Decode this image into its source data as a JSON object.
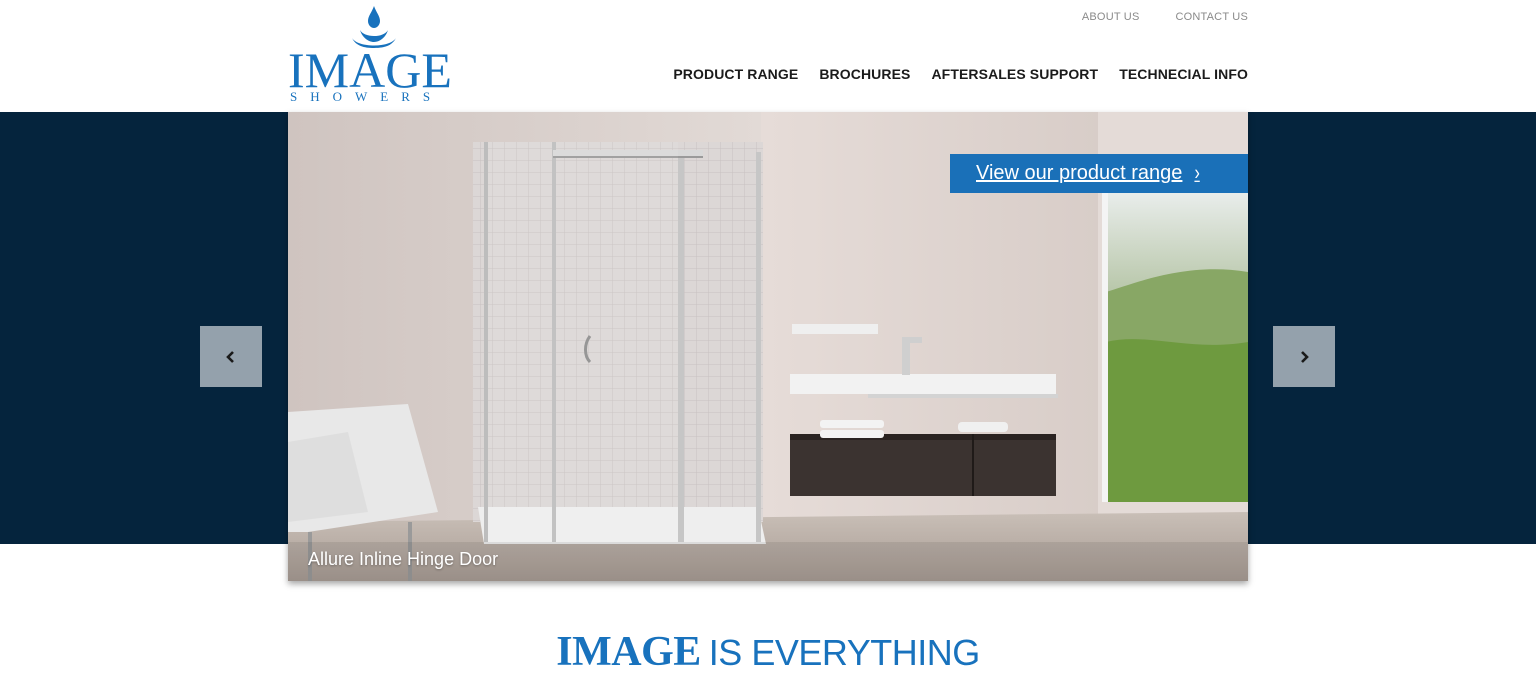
{
  "brand": {
    "name": "IMAGE",
    "subtitle": "SHOWERS",
    "color": "#1872bd"
  },
  "top_links": [
    "ABOUT US",
    "CONTACT US"
  ],
  "main_nav": [
    "PRODUCT RANGE",
    "BROCHURES",
    "AFTERSALES SUPPORT",
    "TECHNECIAL INFO"
  ],
  "slider": {
    "cta_label": "View our product range",
    "caption": "Allure Inline Hinge Door",
    "prev_icon": "chevron-left-icon",
    "next_icon": "chevron-right-icon"
  },
  "tagline": {
    "brand": "IMAGE",
    "rest": "IS EVERYTHING"
  },
  "colors": {
    "band": "#05243d",
    "accent": "#1a70b8",
    "arrow_bg": "#94a1ac"
  }
}
